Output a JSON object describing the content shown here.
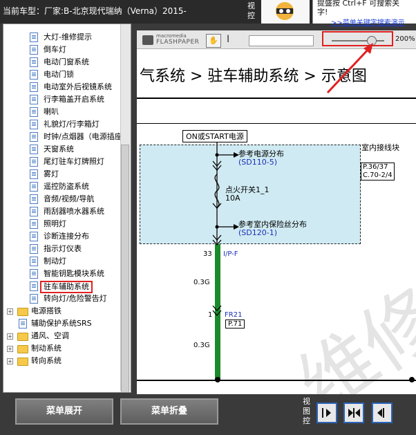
{
  "header": {
    "title": "当前车型：厂家:B-北京现代瑞纳（Verna）2015-",
    "view_label": "视控",
    "tip_text": "提盛按 Ctrl+F 可搜索关\n字!",
    "tip_link": ">>菜单关键字搜索演示"
  },
  "tree": {
    "items": [
      {
        "label": "大灯-维修提示",
        "type": "doc"
      },
      {
        "label": "倒车灯",
        "type": "doc"
      },
      {
        "label": "电动门窗系统",
        "type": "doc"
      },
      {
        "label": "电动门锁",
        "type": "doc"
      },
      {
        "label": "电动室外后视镜系统",
        "type": "doc"
      },
      {
        "label": "行李箱盖开启系统",
        "type": "doc"
      },
      {
        "label": "喇叭",
        "type": "doc"
      },
      {
        "label": "礼貌灯/行李箱灯",
        "type": "doc"
      },
      {
        "label": "时钟/点烟器（电源插座",
        "type": "doc"
      },
      {
        "label": "天窗系统",
        "type": "doc"
      },
      {
        "label": "尾灯驻车灯牌照灯",
        "type": "doc"
      },
      {
        "label": "雾灯",
        "type": "doc"
      },
      {
        "label": "遥控防盗系统",
        "type": "doc"
      },
      {
        "label": "音频/视频/导航",
        "type": "doc"
      },
      {
        "label": "雨刮器喷水器系统",
        "type": "doc"
      },
      {
        "label": "照明灯",
        "type": "doc"
      },
      {
        "label": "诊断连接分布",
        "type": "doc"
      },
      {
        "label": "指示灯仪表",
        "type": "doc"
      },
      {
        "label": "制动灯",
        "type": "doc"
      },
      {
        "label": "智能钥匙模块系统",
        "type": "doc"
      },
      {
        "label": "驻车辅助系统",
        "type": "doc",
        "selected": true
      },
      {
        "label": "转向灯/危险警告灯",
        "type": "doc"
      },
      {
        "label": "电源搭铁",
        "type": "folder"
      },
      {
        "label": "辅助保护系统SRS",
        "type": "doc"
      },
      {
        "label": "通风、空调",
        "type": "folder"
      },
      {
        "label": "制动系统",
        "type": "folder"
      },
      {
        "label": "转向系统",
        "type": "folder"
      }
    ]
  },
  "viewer": {
    "logo_top": "macromedia",
    "logo_bottom": "FLASHPAPER",
    "zoom": "200%",
    "zoom_fraction": 0.75
  },
  "diagram": {
    "title": "气系统 > 驻车辅助系统 > 示意图",
    "on_start": "ON或START电源",
    "ref_power": "参考电源分布",
    "sd110": "(SD110-5)",
    "ignition": "点火开关1_1",
    "amps": "10A",
    "ref_fuse": "参考室内保险丝分布",
    "sd120": "(SD120-1)",
    "junction": "室内接线块",
    "pin_a": "P.36/37",
    "pin_b": "C.70-2/4",
    "pin_33": "33",
    "ipf": "I/P-F",
    "wire_a": "0.3G",
    "pin_1": "1",
    "fr21": "FR21",
    "p71": "P.71",
    "wire_b": "0.3G",
    "watermark": "维修"
  },
  "buttons": {
    "expand": "菜单展开",
    "collapse": "菜单折叠",
    "view_ctrl": "视图控"
  }
}
